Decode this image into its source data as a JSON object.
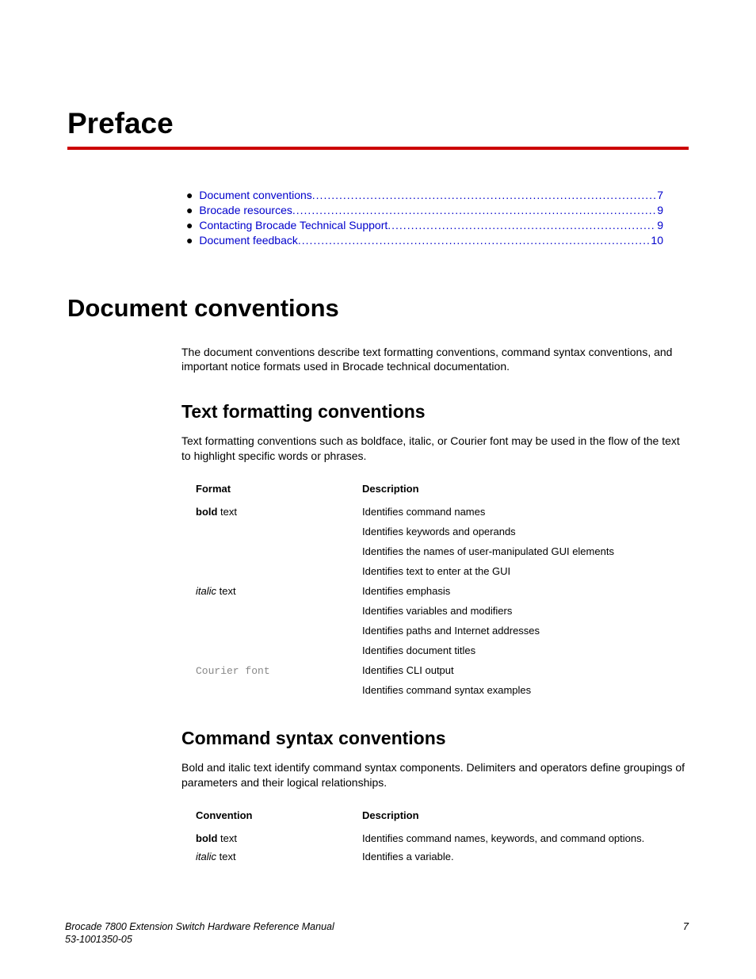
{
  "chapter": {
    "title": "Preface"
  },
  "toc": {
    "items": [
      {
        "label": "Document conventions",
        "page": "7"
      },
      {
        "label": "Brocade resources",
        "page": "9"
      },
      {
        "label": "Contacting Brocade Technical Support",
        "page": "9"
      },
      {
        "label": "Document feedback",
        "page": "10"
      }
    ]
  },
  "section": {
    "title": "Document conventions",
    "intro": "The document conventions describe text formatting conventions, command syntax conventions, and important notice formats used in Brocade technical documentation."
  },
  "text_formatting": {
    "title": "Text formatting conventions",
    "intro": "Text formatting conventions such as boldface, italic, or Courier font may be used in the flow of the text to highlight specific words or phrases.",
    "headers": {
      "format": "Format",
      "description": "Description"
    },
    "rows": [
      {
        "format_prefix": "bold",
        "format_suffix": " text",
        "descriptions": [
          "Identifies command names",
          "Identifies keywords and operands",
          "Identifies the names of user-manipulated GUI elements",
          "Identifies text to enter at the GUI"
        ]
      },
      {
        "format_prefix": "italic",
        "format_suffix": " text",
        "descriptions": [
          "Identifies emphasis",
          "Identifies variables and modifiers",
          "Identifies paths and Internet addresses",
          "Identifies document titles"
        ]
      },
      {
        "format_prefix": "Courier font",
        "format_suffix": "",
        "descriptions": [
          "Identifies CLI output",
          "Identifies command syntax examples"
        ]
      }
    ]
  },
  "command_syntax": {
    "title": "Command syntax conventions",
    "intro": "Bold and italic text identify command syntax components. Delimiters and operators define groupings of parameters and their logical relationships.",
    "headers": {
      "convention": "Convention",
      "description": "Description"
    },
    "rows": [
      {
        "format_prefix": "bold",
        "format_suffix": " text",
        "description": "Identifies command names, keywords, and command options."
      },
      {
        "format_prefix": "italic",
        "format_suffix": " text",
        "description": "Identifies a variable."
      }
    ]
  },
  "footer": {
    "line1": "Brocade 7800 Extension Switch Hardware Reference Manual",
    "line2": "53-1001350-05",
    "page": "7"
  }
}
